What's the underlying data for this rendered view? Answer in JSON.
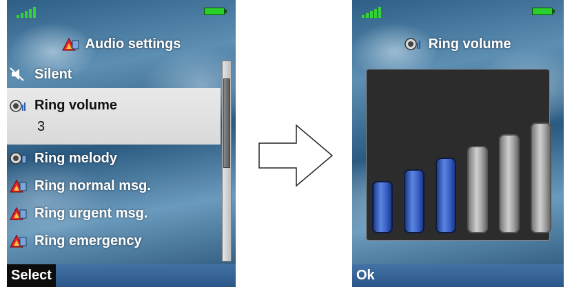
{
  "colors": {
    "screen_gradient_dark": "#244f72",
    "screen_gradient_light": "#6a9abd",
    "selected_row": "#e0e0e0",
    "softkey_bar": "#3a6699",
    "bar_active": "#3d63c9",
    "bar_inactive": "#a8a8a8"
  },
  "left_screen": {
    "status": {
      "signal_icon": "signal-strength-icon",
      "battery_icon": "battery-full-icon"
    },
    "title": "Audio settings",
    "title_icon": "audio-settings-icon",
    "menu": [
      {
        "label": "Silent",
        "icon": "silent-mode-icon"
      },
      {
        "label": "Ring volume",
        "value": "3",
        "icon": "speaker-icon",
        "selected": true
      },
      {
        "label": "Ring melody",
        "icon": "speaker-icon"
      },
      {
        "label": "Ring normal msg.",
        "icon": "audio-settings-icon"
      },
      {
        "label": "Ring urgent msg.",
        "icon": "audio-settings-icon"
      },
      {
        "label": "Ring emergency",
        "icon": "audio-settings-icon"
      }
    ],
    "scroll_position": 0.15,
    "softkey": "Select"
  },
  "transition_icon": "right-arrow-icon",
  "right_screen": {
    "status": {
      "signal_icon": "signal-strength-icon",
      "battery_icon": "battery-full-icon"
    },
    "title": "Ring volume",
    "title_icon": "speaker-icon",
    "volume_level": 3,
    "volume_max": 6,
    "softkey": "Ok"
  }
}
